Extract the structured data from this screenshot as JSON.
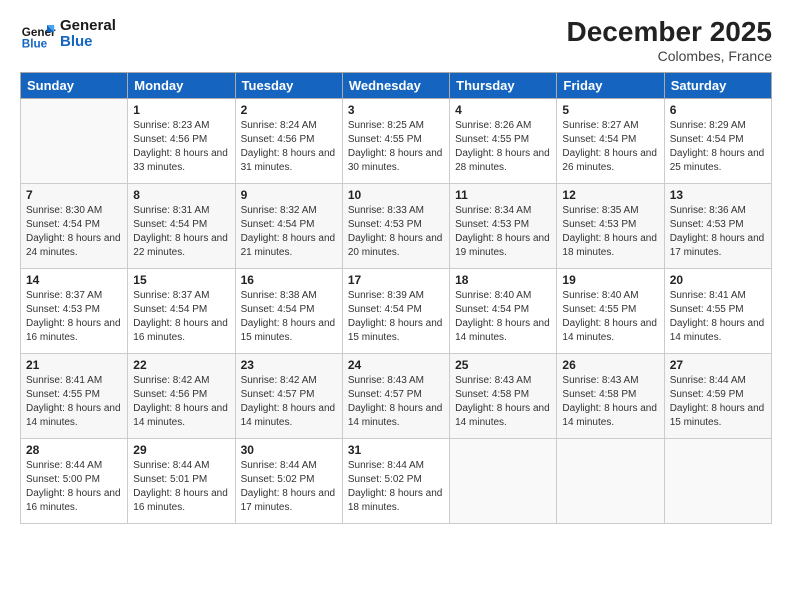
{
  "header": {
    "logo_line1": "General",
    "logo_line2": "Blue",
    "month": "December 2025",
    "location": "Colombes, France"
  },
  "weekdays": [
    "Sunday",
    "Monday",
    "Tuesday",
    "Wednesday",
    "Thursday",
    "Friday",
    "Saturday"
  ],
  "weeks": [
    [
      {
        "day": "",
        "sunrise": "",
        "sunset": "",
        "daylight": ""
      },
      {
        "day": "1",
        "sunrise": "8:23 AM",
        "sunset": "4:56 PM",
        "daylight": "8 hours and 33 minutes."
      },
      {
        "day": "2",
        "sunrise": "8:24 AM",
        "sunset": "4:56 PM",
        "daylight": "8 hours and 31 minutes."
      },
      {
        "day": "3",
        "sunrise": "8:25 AM",
        "sunset": "4:55 PM",
        "daylight": "8 hours and 30 minutes."
      },
      {
        "day": "4",
        "sunrise": "8:26 AM",
        "sunset": "4:55 PM",
        "daylight": "8 hours and 28 minutes."
      },
      {
        "day": "5",
        "sunrise": "8:27 AM",
        "sunset": "4:54 PM",
        "daylight": "8 hours and 26 minutes."
      },
      {
        "day": "6",
        "sunrise": "8:29 AM",
        "sunset": "4:54 PM",
        "daylight": "8 hours and 25 minutes."
      }
    ],
    [
      {
        "day": "7",
        "sunrise": "8:30 AM",
        "sunset": "4:54 PM",
        "daylight": "8 hours and 24 minutes."
      },
      {
        "day": "8",
        "sunrise": "8:31 AM",
        "sunset": "4:54 PM",
        "daylight": "8 hours and 22 minutes."
      },
      {
        "day": "9",
        "sunrise": "8:32 AM",
        "sunset": "4:54 PM",
        "daylight": "8 hours and 21 minutes."
      },
      {
        "day": "10",
        "sunrise": "8:33 AM",
        "sunset": "4:53 PM",
        "daylight": "8 hours and 20 minutes."
      },
      {
        "day": "11",
        "sunrise": "8:34 AM",
        "sunset": "4:53 PM",
        "daylight": "8 hours and 19 minutes."
      },
      {
        "day": "12",
        "sunrise": "8:35 AM",
        "sunset": "4:53 PM",
        "daylight": "8 hours and 18 minutes."
      },
      {
        "day": "13",
        "sunrise": "8:36 AM",
        "sunset": "4:53 PM",
        "daylight": "8 hours and 17 minutes."
      }
    ],
    [
      {
        "day": "14",
        "sunrise": "8:37 AM",
        "sunset": "4:53 PM",
        "daylight": "8 hours and 16 minutes."
      },
      {
        "day": "15",
        "sunrise": "8:37 AM",
        "sunset": "4:54 PM",
        "daylight": "8 hours and 16 minutes."
      },
      {
        "day": "16",
        "sunrise": "8:38 AM",
        "sunset": "4:54 PM",
        "daylight": "8 hours and 15 minutes."
      },
      {
        "day": "17",
        "sunrise": "8:39 AM",
        "sunset": "4:54 PM",
        "daylight": "8 hours and 15 minutes."
      },
      {
        "day": "18",
        "sunrise": "8:40 AM",
        "sunset": "4:54 PM",
        "daylight": "8 hours and 14 minutes."
      },
      {
        "day": "19",
        "sunrise": "8:40 AM",
        "sunset": "4:55 PM",
        "daylight": "8 hours and 14 minutes."
      },
      {
        "day": "20",
        "sunrise": "8:41 AM",
        "sunset": "4:55 PM",
        "daylight": "8 hours and 14 minutes."
      }
    ],
    [
      {
        "day": "21",
        "sunrise": "8:41 AM",
        "sunset": "4:55 PM",
        "daylight": "8 hours and 14 minutes."
      },
      {
        "day": "22",
        "sunrise": "8:42 AM",
        "sunset": "4:56 PM",
        "daylight": "8 hours and 14 minutes."
      },
      {
        "day": "23",
        "sunrise": "8:42 AM",
        "sunset": "4:57 PM",
        "daylight": "8 hours and 14 minutes."
      },
      {
        "day": "24",
        "sunrise": "8:43 AM",
        "sunset": "4:57 PM",
        "daylight": "8 hours and 14 minutes."
      },
      {
        "day": "25",
        "sunrise": "8:43 AM",
        "sunset": "4:58 PM",
        "daylight": "8 hours and 14 minutes."
      },
      {
        "day": "26",
        "sunrise": "8:43 AM",
        "sunset": "4:58 PM",
        "daylight": "8 hours and 14 minutes."
      },
      {
        "day": "27",
        "sunrise": "8:44 AM",
        "sunset": "4:59 PM",
        "daylight": "8 hours and 15 minutes."
      }
    ],
    [
      {
        "day": "28",
        "sunrise": "8:44 AM",
        "sunset": "5:00 PM",
        "daylight": "8 hours and 16 minutes."
      },
      {
        "day": "29",
        "sunrise": "8:44 AM",
        "sunset": "5:01 PM",
        "daylight": "8 hours and 16 minutes."
      },
      {
        "day": "30",
        "sunrise": "8:44 AM",
        "sunset": "5:02 PM",
        "daylight": "8 hours and 17 minutes."
      },
      {
        "day": "31",
        "sunrise": "8:44 AM",
        "sunset": "5:02 PM",
        "daylight": "8 hours and 18 minutes."
      },
      {
        "day": "",
        "sunrise": "",
        "sunset": "",
        "daylight": ""
      },
      {
        "day": "",
        "sunrise": "",
        "sunset": "",
        "daylight": ""
      },
      {
        "day": "",
        "sunrise": "",
        "sunset": "",
        "daylight": ""
      }
    ]
  ],
  "labels": {
    "sunrise_prefix": "Sunrise: ",
    "sunset_prefix": "Sunset: ",
    "daylight_prefix": "Daylight: "
  }
}
